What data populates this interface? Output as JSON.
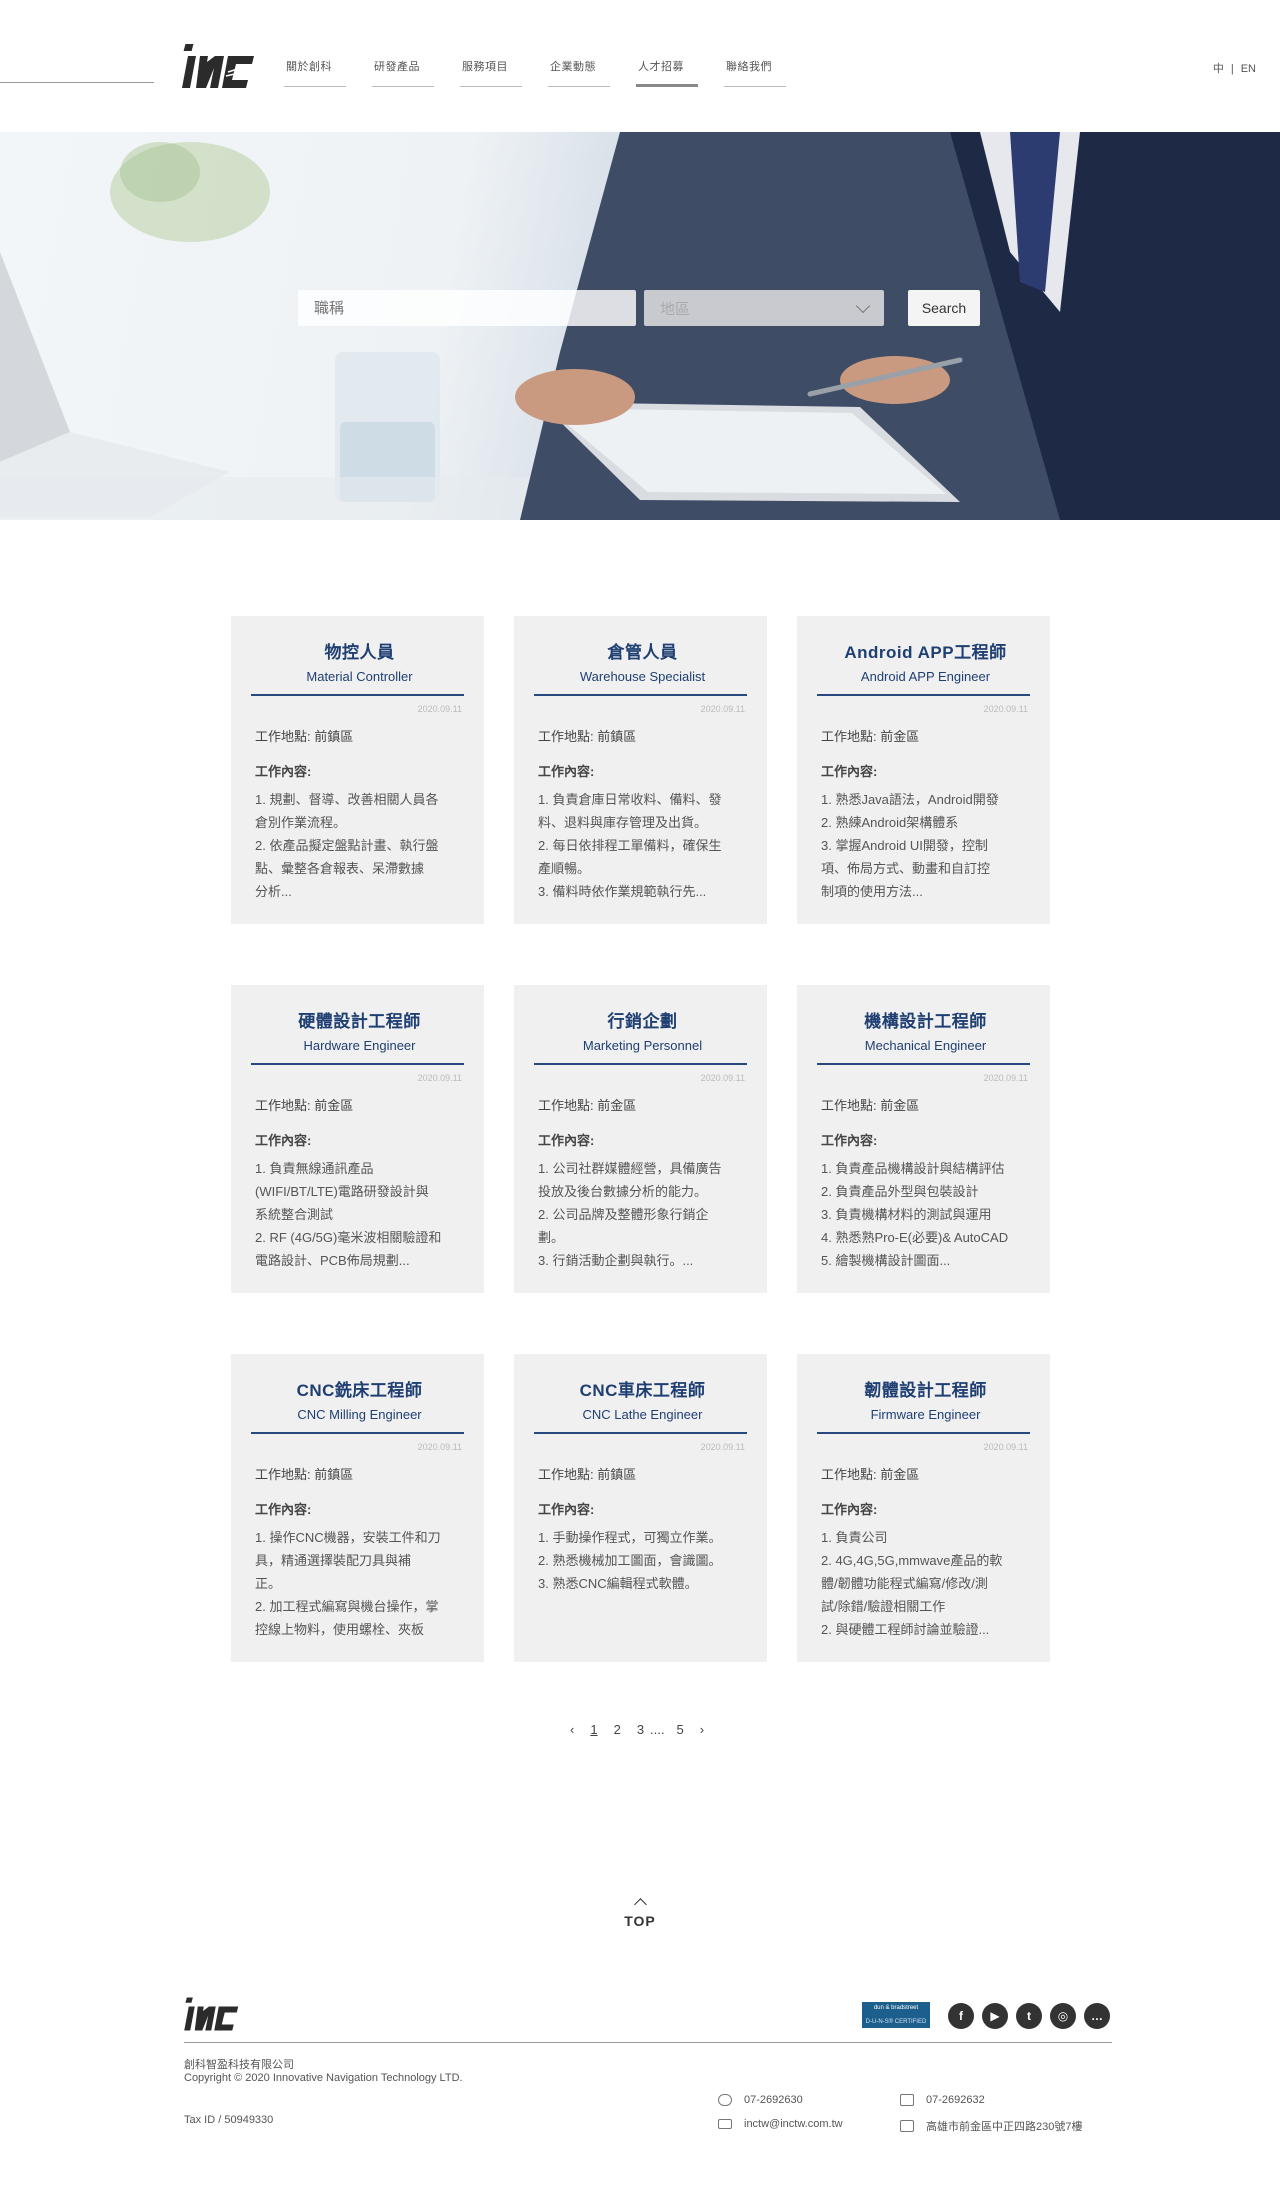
{
  "header": {
    "nav": [
      "關於創科",
      "研發產品",
      "服務項目",
      "企業動態",
      "人才招募",
      "聯絡我們"
    ],
    "active_index": 4,
    "lang_zh": "中",
    "lang_sep": "|",
    "lang_en": "EN"
  },
  "search": {
    "keyword_placeholder": "職稱",
    "region_placeholder": "地區",
    "button": "Search"
  },
  "jobs": [
    {
      "title": "物控人員",
      "subtitle": "Material Controller",
      "date": "2020.09.11",
      "location": "工作地點: 前鎮區",
      "jd_label": "工作內容:",
      "desc": "1. 規劃、督導、改善相關人員各\n    倉別作業流程。\n2. 依產品擬定盤點計畫、執行盤\n    點、彙整各倉報表、呆滯數據\n    分析..."
    },
    {
      "title": "倉管人員",
      "subtitle": "Warehouse Specialist",
      "date": "2020.09.11",
      "location": "工作地點: 前鎮區",
      "jd_label": "工作內容:",
      "desc": "1. 負責倉庫日常收料、備料、發\n    料、退料與庫存管理及出貨。\n2. 每日依排程工單備料，確保生\n    產順暢。\n3. 備料時依作業規範執行先..."
    },
    {
      "title": "Android APP工程師",
      "subtitle": "Android APP Engineer",
      "date": "2020.09.11",
      "location": "工作地點: 前金區",
      "jd_label": "工作內容:",
      "desc": "1. 熟悉Java語法，Android開發\n2. 熟練Android架構體系\n3. 掌握Android UI開發，控制\n    項、佈局方式、動畫和自訂控\n    制項的使用方法..."
    },
    {
      "title": "硬體設計工程師",
      "subtitle": "Hardware Engineer",
      "date": "2020.09.11",
      "location": "工作地點: 前金區",
      "jd_label": "工作內容:",
      "desc": "1. 負責無線通訊產品\n    (WIFI/BT/LTE)電路研發設計與\n    系統整合測試\n2. RF (4G/5G)毫米波相關驗證和\n    電路設計、PCB佈局規劃..."
    },
    {
      "title": "行銷企劃",
      "subtitle": "Marketing Personnel",
      "date": "2020.09.11",
      "location": "工作地點: 前金區",
      "jd_label": "工作內容:",
      "desc": "1. 公司社群媒體經營，具備廣告\n    投放及後台數據分析的能力。\n2. 公司品牌及整體形象行銷企\n    劃。\n3. 行銷活動企劃與執行。..."
    },
    {
      "title": "機構設計工程師",
      "subtitle": "Mechanical Engineer",
      "date": "2020.09.11",
      "location": "工作地點: 前金區",
      "jd_label": "工作內容:",
      "desc": "1. 負責產品機構設計與結構評估\n2. 負責產品外型與包裝設計\n3. 負責機構材料的測試與運用\n4. 熟悉熟Pro-E(必要)& AutoCAD\n5. 繪製機構設計圖面..."
    },
    {
      "title": "CNC銑床工程師",
      "subtitle": "CNC Milling Engineer",
      "date": "2020.09.11",
      "location": "工作地點: 前鎮區",
      "jd_label": "工作內容:",
      "desc": "1. 操作CNC機器，安裝工件和刀\n    具，精通選擇裝配刀具與補\n正。\n2. 加工程式編寫與機台操作，掌\n    控線上物料，使用螺栓、夾板"
    },
    {
      "title": "CNC車床工程師",
      "subtitle": "CNC Lathe Engineer",
      "date": "2020.09.11",
      "location": "工作地點: 前鎮區",
      "jd_label": "工作內容:",
      "desc": "1. 手動操作程式，可獨立作業。\n2. 熟悉機械加工圖面，會識圖。\n3. 熟悉CNC編輯程式軟體。"
    },
    {
      "title": "韌體設計工程師",
      "subtitle": "Firmware Engineer",
      "date": "2020.09.11",
      "location": "工作地點: 前金區",
      "jd_label": "工作內容:",
      "desc": "1. 負責公司\n2. 4G,4G,5G,mmwave產品的軟\n    體/韌體功能程式編寫/修改/測\n    試/除錯/驗證相關工作\n2. 與硬體工程師討論並驗證..."
    }
  ],
  "pagination": {
    "prev": "‹",
    "pages": [
      "1",
      "2",
      "3"
    ],
    "ellipsis": "....",
    "last": "5",
    "next": "›",
    "current": "1"
  },
  "top": {
    "label": "TOP"
  },
  "footer": {
    "dnb_line1": "dun & bradstreet",
    "dnb_line2": "D-U-N-S® CERTIFIED",
    "socials": [
      "f",
      "▶",
      "t",
      "◎",
      "…"
    ],
    "company_zh": "創科智盈科技有限公司",
    "company_en": "Copyright © 2020 Innovative Navigation Technology LTD.",
    "tax_id": "Tax ID / 50949330",
    "phone": "07-2692630",
    "fax": "07-2692632",
    "email": "inctw@inctw.com.tw",
    "address": "高雄市前金區中正四路230號7樓"
  }
}
